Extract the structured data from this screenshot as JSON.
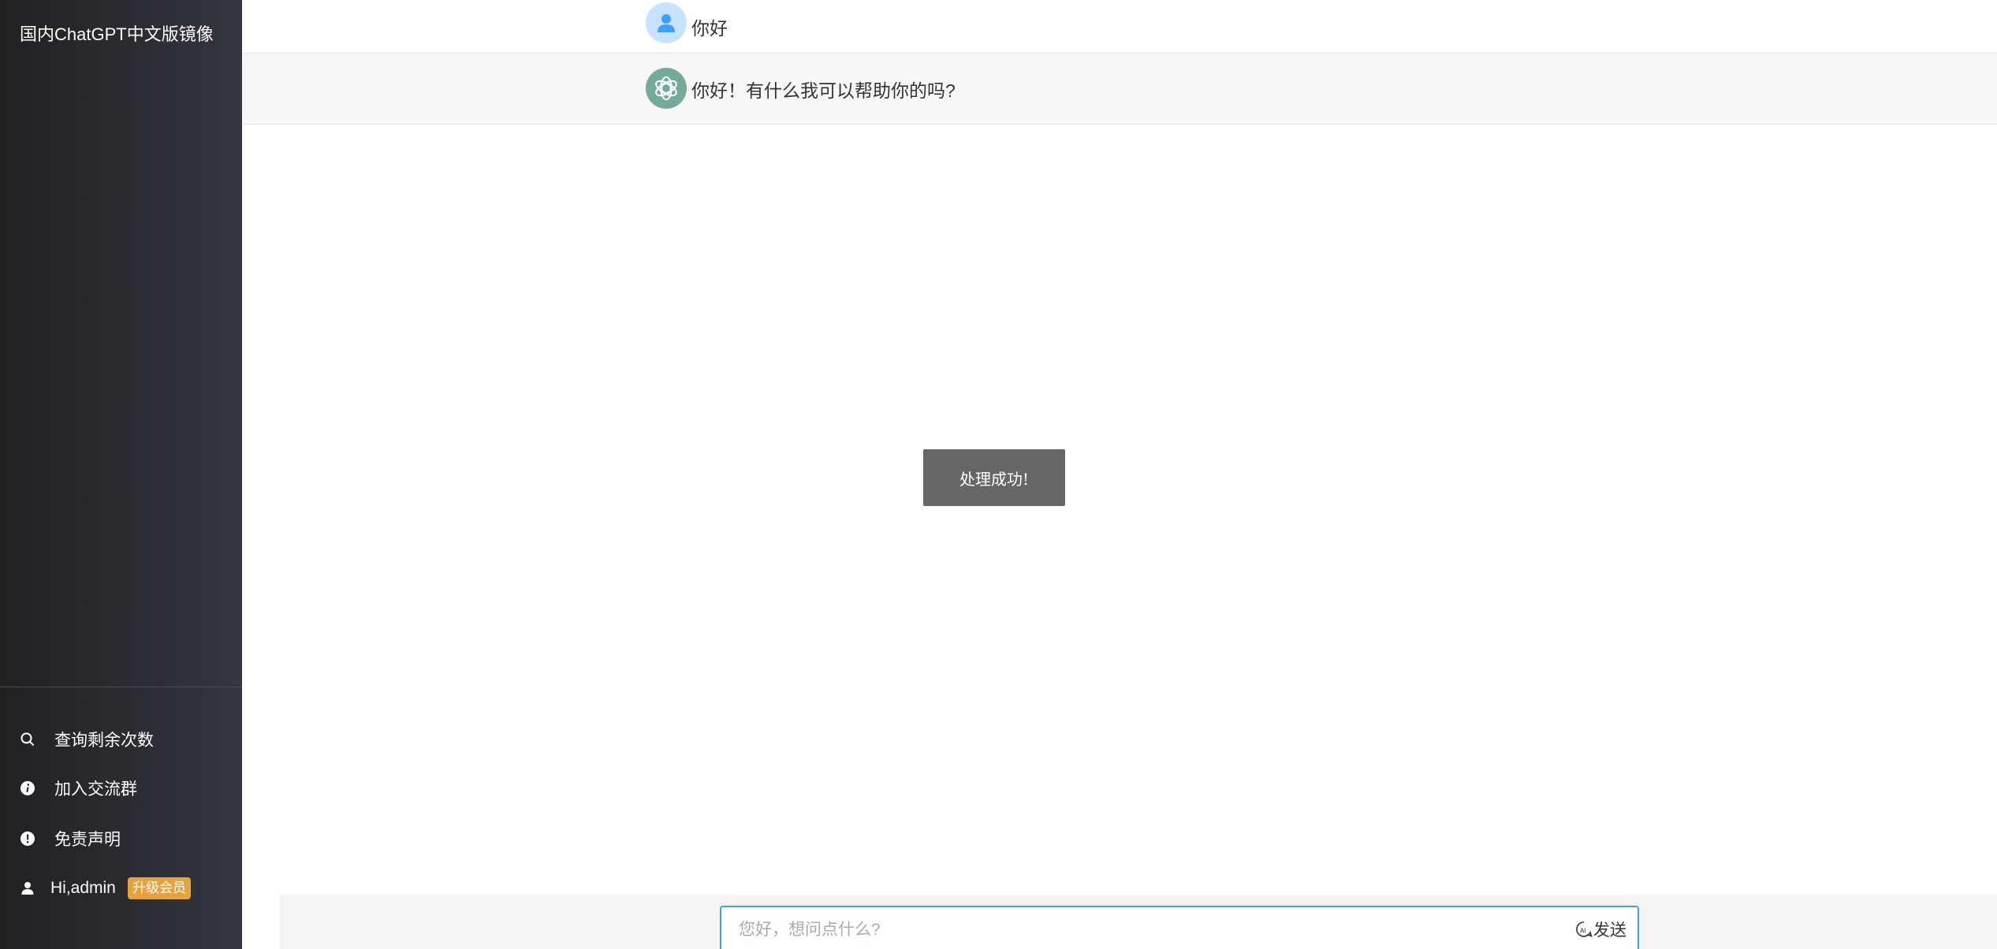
{
  "sidebar": {
    "title": "国内ChatGPT中文版镜像",
    "items": [
      {
        "label": "查询剩余次数",
        "icon": "search-icon"
      },
      {
        "label": "加入交流群",
        "icon": "info-icon"
      },
      {
        "label": "免责声明",
        "icon": "warning-icon"
      }
    ],
    "user": {
      "label": "Hi,admin",
      "icon": "user-icon",
      "badge": "升级会员",
      "badge_color": "#e6a23c"
    },
    "gradient_start": "#202123",
    "gradient_end": "#343640"
  },
  "chat": {
    "messages": [
      {
        "role": "user",
        "text": "你好",
        "avatar_icon": "user-avatar-icon"
      },
      {
        "role": "assistant",
        "text": "你好！有什么我可以帮助你的吗?",
        "avatar_icon": "openai-logo-icon"
      }
    ],
    "assistant_row_bg": "#f7f7f8",
    "assistant_avatar_color": "#74aa9c",
    "user_avatar_color": "#c6e2ff"
  },
  "toast": {
    "text": "处理成功!"
  },
  "composer": {
    "placeholder": "您好，想问点什么?",
    "value": "",
    "send_label": "发送",
    "send_icon": "ai-send-icon",
    "accent": "#409eff"
  }
}
